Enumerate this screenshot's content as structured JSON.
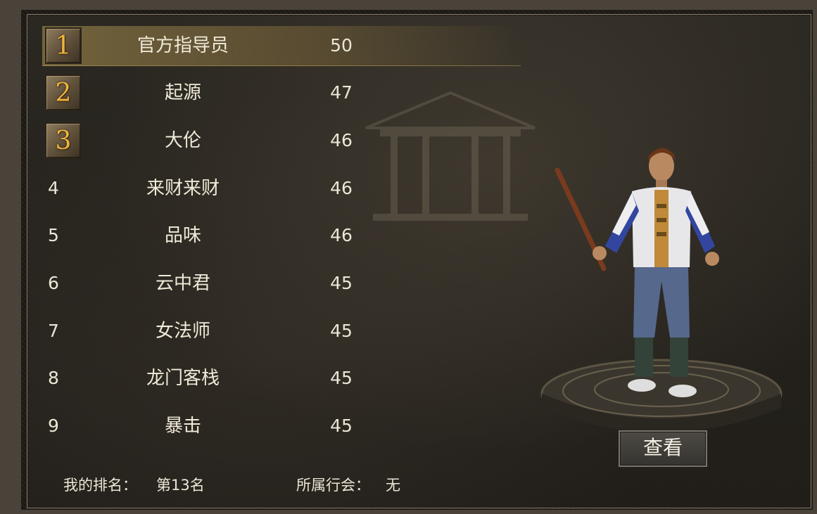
{
  "ranking": [
    {
      "rank": "1",
      "name": "官方指导员",
      "level": "50"
    },
    {
      "rank": "2",
      "name": "起源",
      "level": "47"
    },
    {
      "rank": "3",
      "name": "大伦",
      "level": "46"
    },
    {
      "rank": "4",
      "name": "来财来财",
      "level": "46"
    },
    {
      "rank": "5",
      "name": "品味",
      "level": "46"
    },
    {
      "rank": "6",
      "name": "云中君",
      "level": "45"
    },
    {
      "rank": "7",
      "name": "女法师",
      "level": "45"
    },
    {
      "rank": "8",
      "name": "龙门客栈",
      "level": "45"
    },
    {
      "rank": "9",
      "name": "暴击",
      "level": "45"
    }
  ],
  "footer": {
    "my_rank_label": "我的排名：",
    "my_rank_value": "第13名",
    "guild_label": "所属行会：",
    "guild_value": "无"
  },
  "view_button_label": "查看",
  "colors": {
    "badge_gold": "#f0b23e",
    "highlight": "#8c7846",
    "panel_bg": "#25221d",
    "text": "#ece6d6"
  }
}
